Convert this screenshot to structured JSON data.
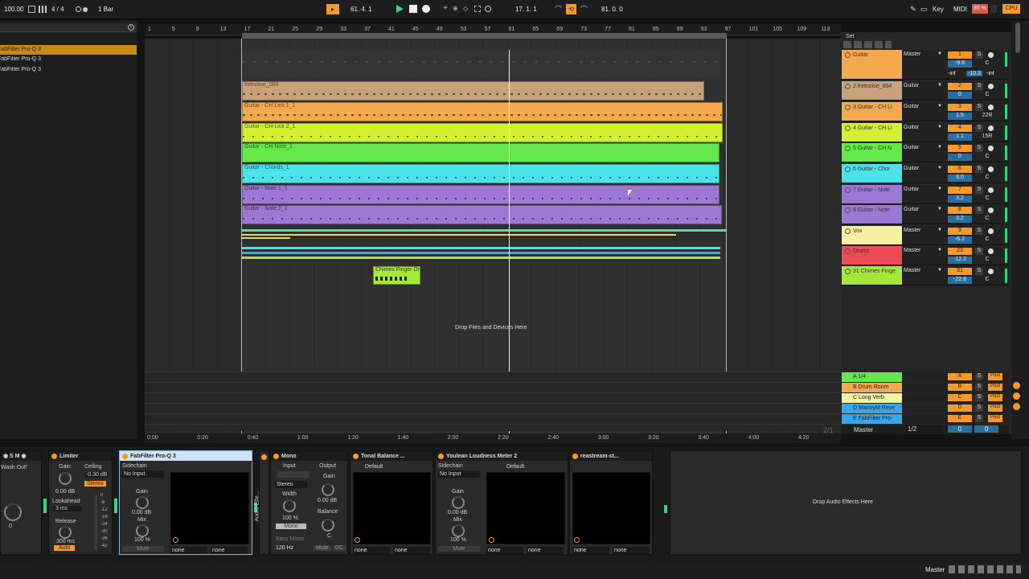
{
  "transport": {
    "tempo": "100.00",
    "time_sig": "4 / 4",
    "quantize": "1 Bar",
    "position": "61.  4.  1",
    "loop_start": "17.  1.  1",
    "loop_len": "81.  0.  0",
    "key_label": "Key",
    "midi_label": "MIDI",
    "cpu_value": "85 %",
    "cpu_label": "CPU"
  },
  "browser": {
    "items": [
      "FabFilter Pro-Q 3",
      "FabFilter Pro-Q 3",
      "FabFilter Pro-Q 3"
    ]
  },
  "ruler": {
    "bars": [
      "1",
      "5",
      "9",
      "13",
      "17",
      "21",
      "25",
      "29",
      "33",
      "37",
      "41",
      "45",
      "49",
      "53",
      "57",
      "61",
      "65",
      "69",
      "73",
      "77",
      "81",
      "85",
      "89",
      "93",
      "97",
      "101",
      "105",
      "109",
      "113"
    ],
    "times": [
      "0:00",
      "0:20",
      "0:40",
      "1:00",
      "1:20",
      "1:40",
      "2:00",
      "2:20",
      "2:40",
      "3:00",
      "3:20",
      "3:40",
      "4:00",
      "4:20"
    ],
    "zoom": "2/1"
  },
  "clips": {
    "fretnoise": "fretnoise_004",
    "lick1": "Guitar - CH Lick 1_1",
    "lick2": "Guitar - CH Lick 2_1",
    "chnote": "Guitar - CH Note_1",
    "chords": "Guitar - Chords_1",
    "note1": "Guitar - Note 1_1",
    "note2": "Guitar - Note 2_1",
    "chimes": "Chimes Finger Dr"
  },
  "drop_files": "Drop Files and Devices Here",
  "set_label": "Set",
  "tracks": [
    {
      "name": "Guitar",
      "route": "Master",
      "num": "1",
      "vol": "-9.6",
      "pan": "C",
      "color": "#f4a94e",
      "extra1": "-inf",
      "extra2": "-10.3",
      "extra3": "-inf"
    },
    {
      "name": "2 fretnoise_004",
      "route": "Guitar",
      "num": "2",
      "vol": "0",
      "pan": "C",
      "color": "#c8a27a"
    },
    {
      "name": "3 Guitar - CH Li",
      "route": "Guitar",
      "num": "3",
      "vol": "1.5",
      "pan": "22R",
      "color": "#f4a94e"
    },
    {
      "name": "4 Guitar - CH Li",
      "route": "Guitar",
      "num": "4",
      "vol": "1.1",
      "pan": "15R",
      "color": "#d4f12f"
    },
    {
      "name": "5 Guitar - CH N",
      "route": "Guitar",
      "num": "5",
      "vol": "0",
      "pan": "C",
      "color": "#64e84a"
    },
    {
      "name": "6 Guitar - Chor",
      "route": "Guitar",
      "num": "6",
      "vol": "6.0",
      "pan": "C",
      "color": "#4be3e8"
    },
    {
      "name": "7 Guitar - Note",
      "route": "Guitar",
      "num": "7",
      "vol": "3.2",
      "pan": "C",
      "color": "#9a78d4"
    },
    {
      "name": "8 Guitar - Note",
      "route": "Guitar",
      "num": "8",
      "vol": "3.2",
      "pan": "C",
      "color": "#9a78d4"
    },
    {
      "name": "Vox",
      "route": "Master",
      "num": "9",
      "vol": "-6.2",
      "pan": "C",
      "color": "#f6f0a0"
    },
    {
      "name": "Drums",
      "route": "Master",
      "num": "23",
      "vol": "-12.2",
      "pan": "C",
      "color": "#ee4a55"
    },
    {
      "name": "31 Chimes Finge",
      "route": "Master",
      "num": "31",
      "vol": "-22.8",
      "pan": "C",
      "color": "#a5e83a"
    }
  ],
  "returns": [
    {
      "name": "A 1/4",
      "letter": "A",
      "color": "#64e84a"
    },
    {
      "name": "B Drum Room",
      "letter": "B",
      "color": "#f4a94e"
    },
    {
      "name": "C Long Verb",
      "letter": "C",
      "color": "#f6f0a0"
    },
    {
      "name": "D MannyM Reve",
      "letter": "D",
      "color": "#3aa5e8"
    },
    {
      "name": "E FabFilter Pro-",
      "letter": "E",
      "color": "#3aa5e8"
    }
  ],
  "post_label": "Post",
  "master": {
    "name": "Master",
    "route": "1/2",
    "vol": "0",
    "pan": "0"
  },
  "devices": {
    "wash": "Wash Out!",
    "limiter": {
      "title": "Limiter",
      "gain": "Gain",
      "ceiling": "Ceiling",
      "ceiling_val": "-0.30 dB",
      "gain_val": "0.00 dB",
      "stereo": "Stereo",
      "lookahead": "Lookahead",
      "lookahead_val": "3 ms",
      "release": "Release",
      "release_val": "300 ms",
      "auto": "Auto",
      "scale": [
        "0",
        "-6",
        "-12",
        "-18",
        "-24",
        "-30",
        "-36",
        "-42"
      ]
    },
    "proq": {
      "title": "FabFilter Pro-Q 3",
      "sidechain": "Sidechain",
      "input": "No Input",
      "gain": "Gain",
      "gain_val": "0.00 dB",
      "mix": "Mix",
      "mix_val": "100 %",
      "mute": "Mute",
      "none1": "none",
      "none2": "none"
    },
    "mono": {
      "title": "Mono",
      "input": "Input",
      "output": "Output",
      "stereo": "Stereo",
      "width": "Width",
      "width_val": "100 %",
      "mono": "Mono",
      "gain": "Gain",
      "gain_val": "0.00 dB",
      "balance": "Balance",
      "balance_val": "C",
      "bass_mono": "Bass Mono",
      "freq": "120 Hz",
      "mute": "Mute",
      "dc": "DC",
      "side_label": "Audio Effe..."
    },
    "tonal": {
      "title": "Tonal Balance ...",
      "preset": "Default",
      "none1": "none",
      "none2": "none"
    },
    "youlean": {
      "title": "Youlean Loudness Meter 2",
      "sidechain": "Sidechain",
      "input": "No Input",
      "gain": "Gain",
      "gain_val": "0.00 dB",
      "mix": "Mix",
      "mix_val": "100 %",
      "mute": "Mute",
      "preset": "Default",
      "none1": "none",
      "none2": "none"
    },
    "reastream": {
      "title": "reastream-st...",
      "none1": "none",
      "none2": "none"
    },
    "drop": "Drop Audio Effects Here"
  },
  "status": {
    "master": "Master"
  }
}
